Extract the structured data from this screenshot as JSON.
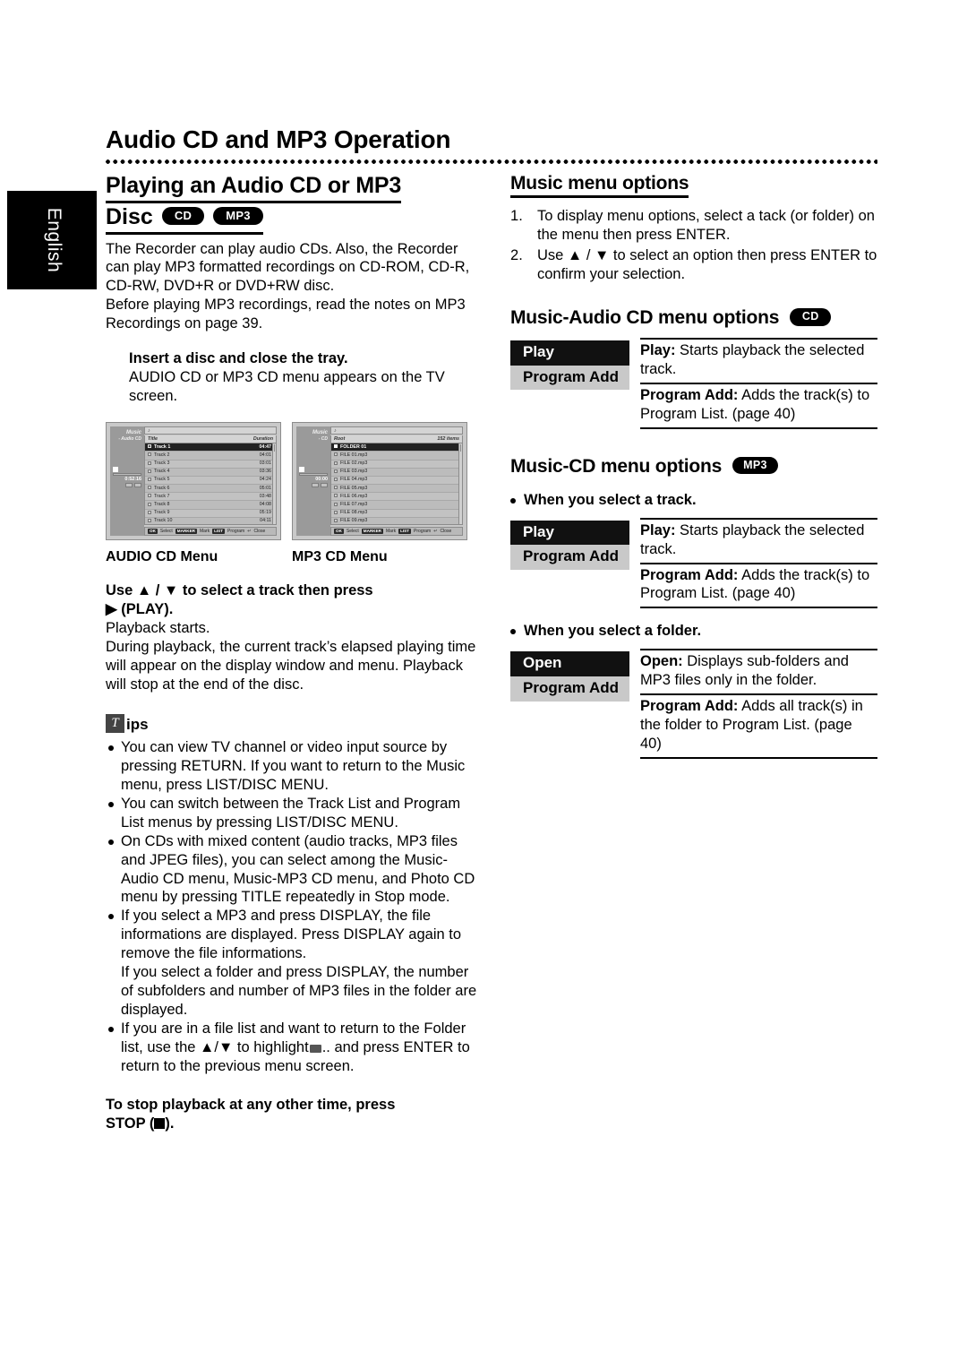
{
  "lang_tab": {
    "label": "English"
  },
  "header": {
    "title": "Audio CD and MP3 Operation"
  },
  "left": {
    "section_title_line1": "Playing an Audio CD or MP3",
    "section_title_line2": "Disc",
    "badges": {
      "cd": "CD",
      "mp3": "MP3"
    },
    "intro": "The Recorder can play audio CDs. Also, the Recorder can play MP3 formatted recordings on CD-ROM, CD-R, CD-RW, DVD+R or DVD+RW disc.",
    "intro2": "Before playing MP3 recordings, read the notes on MP3 Recordings on page 39.",
    "step_insert_bold": "Insert a disc and close the tray.",
    "step_insert_body": "AUDIO CD or MP3 CD menu appears on the TV screen.",
    "audio_cd_menu": {
      "caption": "AUDIO CD Menu",
      "side_title": "Music",
      "side_sub": "- Audio CD",
      "time": "0:52:16",
      "col_title": "Title",
      "col_duration": "Duration",
      "rows": [
        {
          "name": "Track 1",
          "dur": "04:47"
        },
        {
          "name": "Track 2",
          "dur": "04:01"
        },
        {
          "name": "Track 3",
          "dur": "03:01"
        },
        {
          "name": "Track 4",
          "dur": "03:36"
        },
        {
          "name": "Track 5",
          "dur": "04:24"
        },
        {
          "name": "Track 6",
          "dur": "05:01"
        },
        {
          "name": "Track 7",
          "dur": "03:48"
        },
        {
          "name": "Track 8",
          "dur": "04:08"
        },
        {
          "name": "Track 9",
          "dur": "05:19"
        },
        {
          "name": "Track 10",
          "dur": "04:11"
        }
      ]
    },
    "mp3_cd_menu": {
      "caption": "MP3 CD Menu",
      "side_title": "Music",
      "side_sub": "- CD",
      "time": "00:00",
      "col_title": "Root",
      "col_count": "152 items",
      "rows": [
        {
          "name": "FOLDER 01",
          "dur": ""
        },
        {
          "name": "FILE 01.mp3",
          "dur": ""
        },
        {
          "name": "FILE 02.mp3",
          "dur": ""
        },
        {
          "name": "FILE 03.mp3",
          "dur": ""
        },
        {
          "name": "FILE 04.mp3",
          "dur": ""
        },
        {
          "name": "FILE 05.mp3",
          "dur": ""
        },
        {
          "name": "FILE 06.mp3",
          "dur": ""
        },
        {
          "name": "FILE 07.mp3",
          "dur": ""
        },
        {
          "name": "FILE 08.mp3",
          "dur": ""
        },
        {
          "name": "FILE 09.mp3",
          "dur": ""
        }
      ]
    },
    "osd_footer": {
      "ok_key": "OK",
      "ok_label": "Select",
      "marker_key": "MARKER",
      "marker_label": "Mark",
      "list_key": "LIST",
      "list_label": "Program",
      "close_label": "Close"
    },
    "use_select_bold_1": "Use ▲ / ▼ to select a track then press",
    "use_select_bold_2": "▶ (PLAY).",
    "playback_1": "Playback starts.",
    "playback_2": "During playback, the current track’s elapsed playing time will appear on the display window and menu. Playback will stop at the end of the disc.",
    "tips_glyph": "T",
    "tips_label": "ips",
    "tips": [
      "You can view TV channel or video input source by pressing RETURN. If you want to return to the Music menu, press LIST/DISC MENU.",
      "You can switch between the Track List and Program List menus by pressing LIST/DISC MENU.",
      "On CDs with mixed content (audio tracks, MP3 files and JPEG files), you can select among the Music-Audio CD menu, Music-MP3 CD menu, and Photo CD menu by pressing TITLE repeatedly in Stop mode."
    ],
    "tip_display_a": "If you select a MP3 and press DISPLAY, the file informations are displayed. Press DISPLAY again to remove the file informations.",
    "tip_display_b": "If you select a folder and press DISPLAY, the number of subfolders and number of MP3 files in the folder are displayed.",
    "tip_folder_a": "If you are in a file list and want to return to the Folder list, use the ▲/▼ to highlight",
    "tip_folder_b": ".. and press ENTER to return to the previous menu screen.",
    "closing_1": "To stop playback at any other time, press",
    "closing_2": "STOP (",
    "closing_3": ")."
  },
  "right": {
    "music_menu_options": {
      "heading": "Music menu options",
      "steps": [
        "To display menu options, select a tack (or folder) on the menu then press ENTER.",
        "Use ▲ / ▼ to select an option then press ENTER to confirm your selection."
      ]
    },
    "audio_cd_options": {
      "heading": "Music-Audio CD menu options",
      "badge": "CD",
      "keys": [
        {
          "label": "Play",
          "state": "on"
        },
        {
          "label": "Program Add",
          "state": "off"
        }
      ],
      "descs": [
        {
          "term": "Play:",
          "text": " Starts playback the selected track."
        },
        {
          "term": "Program Add:",
          "text": " Adds the track(s) to Program List. (page 40)"
        }
      ]
    },
    "mp3_cd_options": {
      "heading": "Music-CD menu options",
      "badge": "MP3",
      "track_bullet": "When you select a track.",
      "track_keys": [
        {
          "label": "Play",
          "state": "on"
        },
        {
          "label": "Program Add",
          "state": "off"
        }
      ],
      "track_descs": [
        {
          "term": "Play:",
          "text": " Starts playback the selected track."
        },
        {
          "term": "Program Add:",
          "text": " Adds the track(s) to Program List. (page 40)"
        }
      ],
      "folder_bullet": "When you select a folder.",
      "folder_keys": [
        {
          "label": "Open",
          "state": "on"
        },
        {
          "label": "Program Add",
          "state": "off"
        }
      ],
      "folder_descs": [
        {
          "term": "Open:",
          "text": " Displays sub-folders and MP3 files only in the folder."
        },
        {
          "term": "Program Add:",
          "text": " Adds all track(s) in the folder to Program List. (page 40)"
        }
      ]
    }
  }
}
